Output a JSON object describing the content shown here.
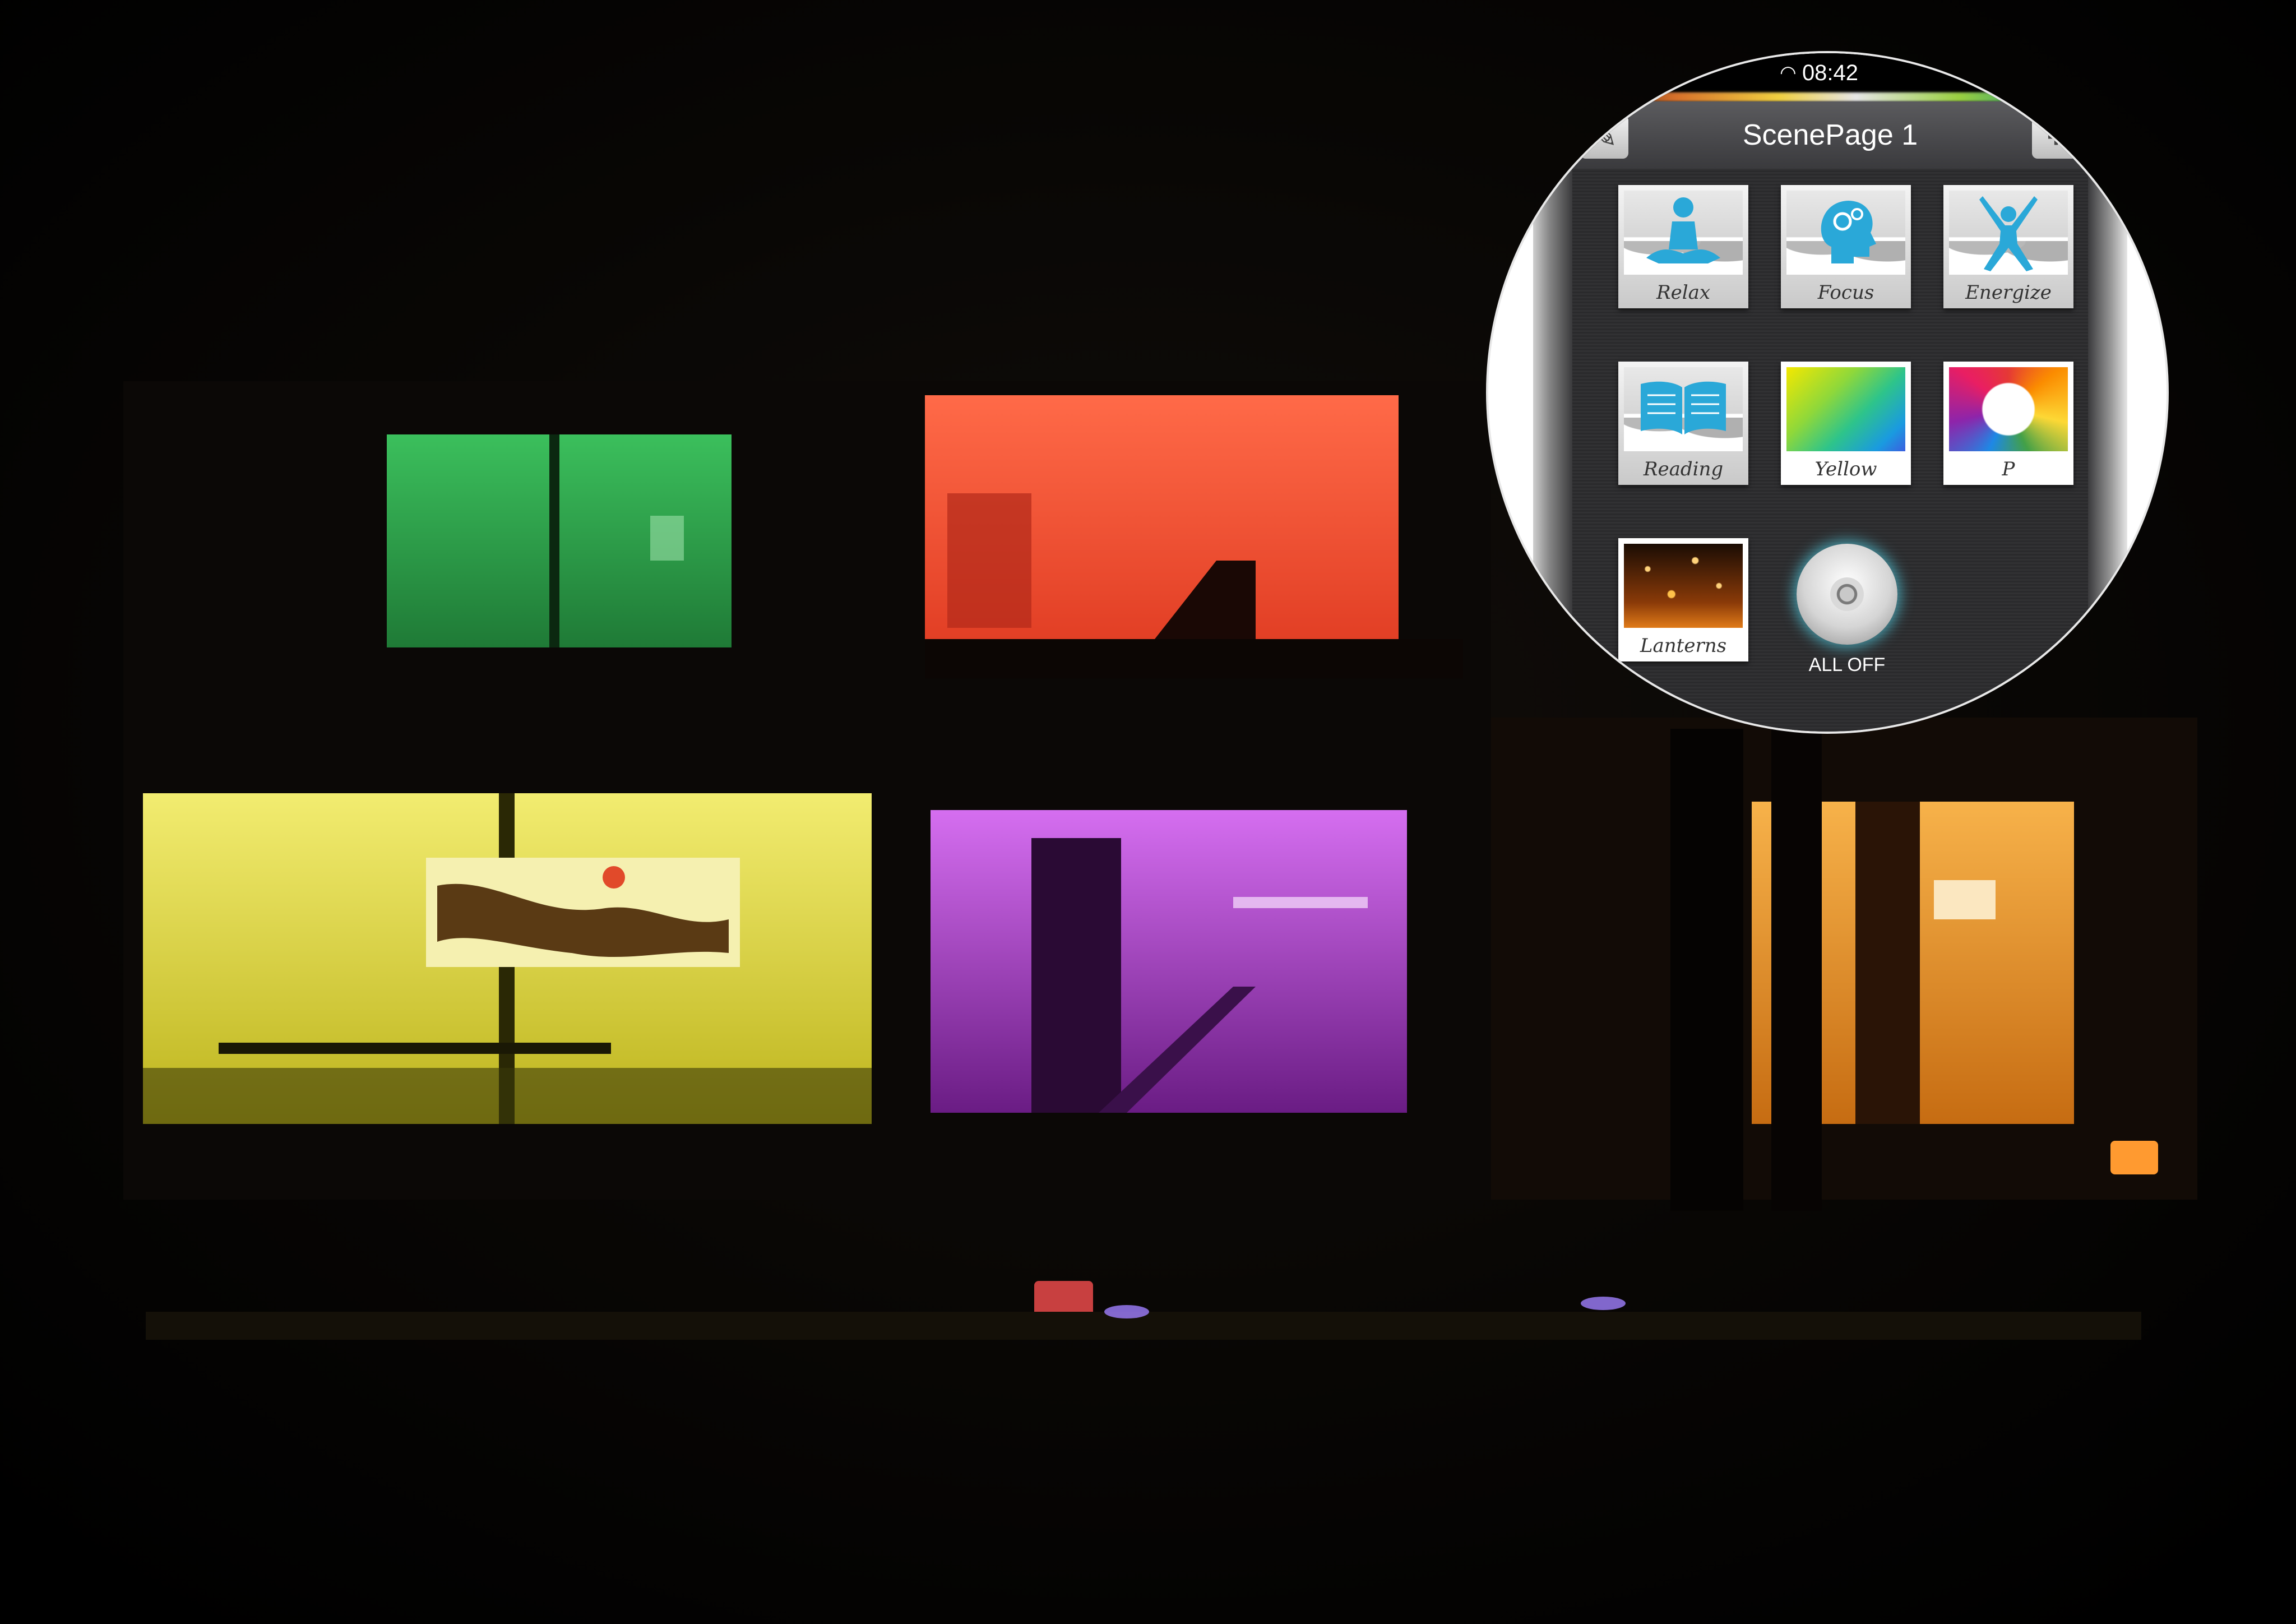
{
  "status_bar": {
    "time": "08:42",
    "wifi_icon": "wifi-icon"
  },
  "nav": {
    "title": "ScenePage 1",
    "edit_icon": "pencil-icon",
    "add_icon": "plus-icon",
    "add_symbol": "+"
  },
  "scenes": [
    {
      "label": "Relax",
      "icon": "meditation-icon"
    },
    {
      "label": "Focus",
      "icon": "head-gears-icon"
    },
    {
      "label": "Energize",
      "icon": "jumping-person-icon"
    },
    {
      "label": "Reading",
      "icon": "open-book-icon"
    },
    {
      "label": "Yellow",
      "icon": "color-gradient-icon"
    },
    {
      "label": "P",
      "icon": "colored-pencils-icon"
    },
    {
      "label": "Lanterns",
      "icon": "lanterns-photo-icon"
    }
  ],
  "all_off": {
    "label": "ALL OFF"
  },
  "colors": {
    "green_room": "#2ea84a",
    "red_room": "#ff5a3c",
    "yellow_room": "#e8e24a",
    "purple_room": "#b93fd6",
    "amber_room": "#f0a030",
    "accent_cyan": "#2aa8d8"
  }
}
